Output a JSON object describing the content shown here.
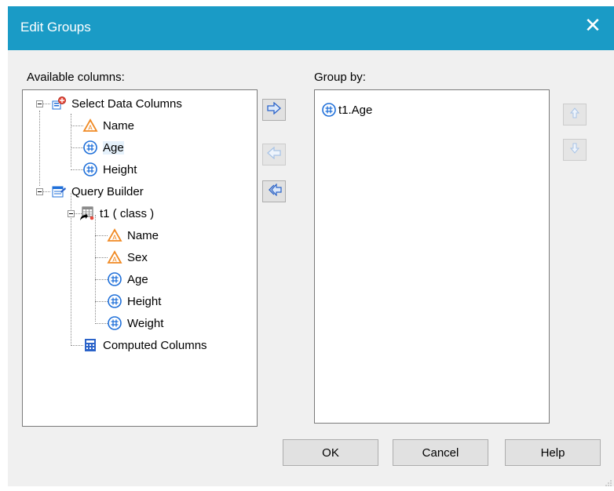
{
  "window": {
    "title": "Edit Groups",
    "close_glyph": "✕"
  },
  "available": {
    "label": "Available columns:",
    "tree": [
      {
        "text": "Select Data Columns",
        "icon": "data-columns-icon",
        "expanded": true
      },
      {
        "text": "Name",
        "icon": "text-column-icon"
      },
      {
        "text": "Age",
        "icon": "numeric-column-icon",
        "selected": true
      },
      {
        "text": "Height",
        "icon": "numeric-column-icon"
      },
      {
        "text": "Query Builder",
        "icon": "query-builder-icon",
        "expanded": true
      },
      {
        "text": "t1 ( class )",
        "icon": "table-shortcut-icon",
        "expanded": true
      },
      {
        "text": "Name",
        "icon": "text-column-icon"
      },
      {
        "text": "Sex",
        "icon": "text-column-icon"
      },
      {
        "text": "Age",
        "icon": "numeric-column-icon"
      },
      {
        "text": "Height",
        "icon": "numeric-column-icon"
      },
      {
        "text": "Weight",
        "icon": "numeric-column-icon"
      },
      {
        "text": "Computed Columns",
        "icon": "calculator-icon"
      }
    ]
  },
  "groupby": {
    "label": "Group by:",
    "items": [
      {
        "text": "t1.Age",
        "icon": "numeric-column-icon"
      }
    ]
  },
  "buttons": {
    "ok": "OK",
    "cancel": "Cancel",
    "help": "Help"
  },
  "colors": {
    "titlebar": "#1a9bc6",
    "text_icon": "#f08a24",
    "num_icon": "#1e6fd9",
    "arrow_active": "#2b63c9",
    "arrow_disabled": "#a9c4e6"
  }
}
